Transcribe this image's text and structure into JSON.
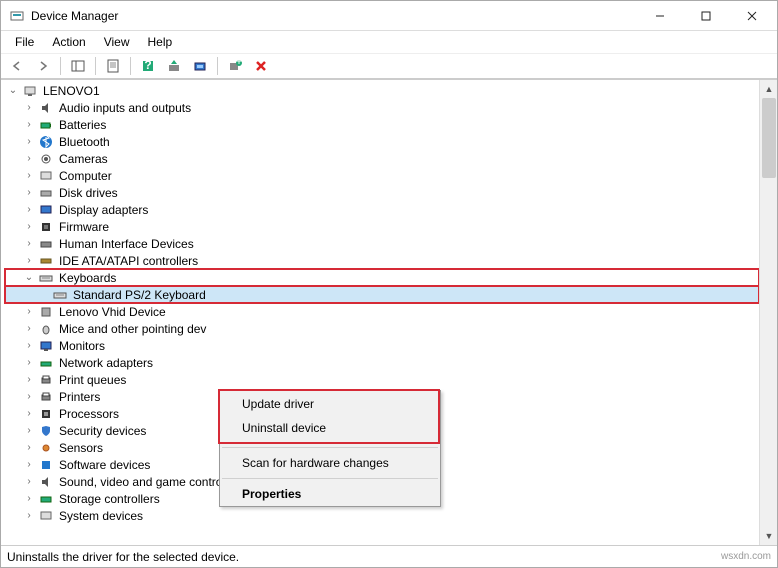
{
  "window": {
    "title": "Device Manager"
  },
  "menu": {
    "file": "File",
    "action": "Action",
    "view": "View",
    "help": "Help"
  },
  "tree": {
    "root": "LENOVO1",
    "nodes": {
      "audio": "Audio inputs and outputs",
      "batteries": "Batteries",
      "bluetooth": "Bluetooth",
      "cameras": "Cameras",
      "computer": "Computer",
      "disk": "Disk drives",
      "display": "Display adapters",
      "firmware": "Firmware",
      "hid": "Human Interface Devices",
      "ide": "IDE ATA/ATAPI controllers",
      "keyboards": "Keyboards",
      "kbd_std": "Standard PS/2 Keyboard",
      "lenovo_vhid": "Lenovo Vhid Device",
      "mice": "Mice and other pointing dev",
      "monitors": "Monitors",
      "network": "Network adapters",
      "printq": "Print queues",
      "printers": "Printers",
      "processors": "Processors",
      "security": "Security devices",
      "sensors": "Sensors",
      "software": "Software devices",
      "sound": "Sound, video and game controllers",
      "storage": "Storage controllers",
      "system": "System devices"
    }
  },
  "context": {
    "update": "Update driver",
    "uninstall": "Uninstall device",
    "scan": "Scan for hardware changes",
    "properties": "Properties"
  },
  "status": "Uninstalls the driver for the selected device.",
  "watermark": "wsxdn.com"
}
